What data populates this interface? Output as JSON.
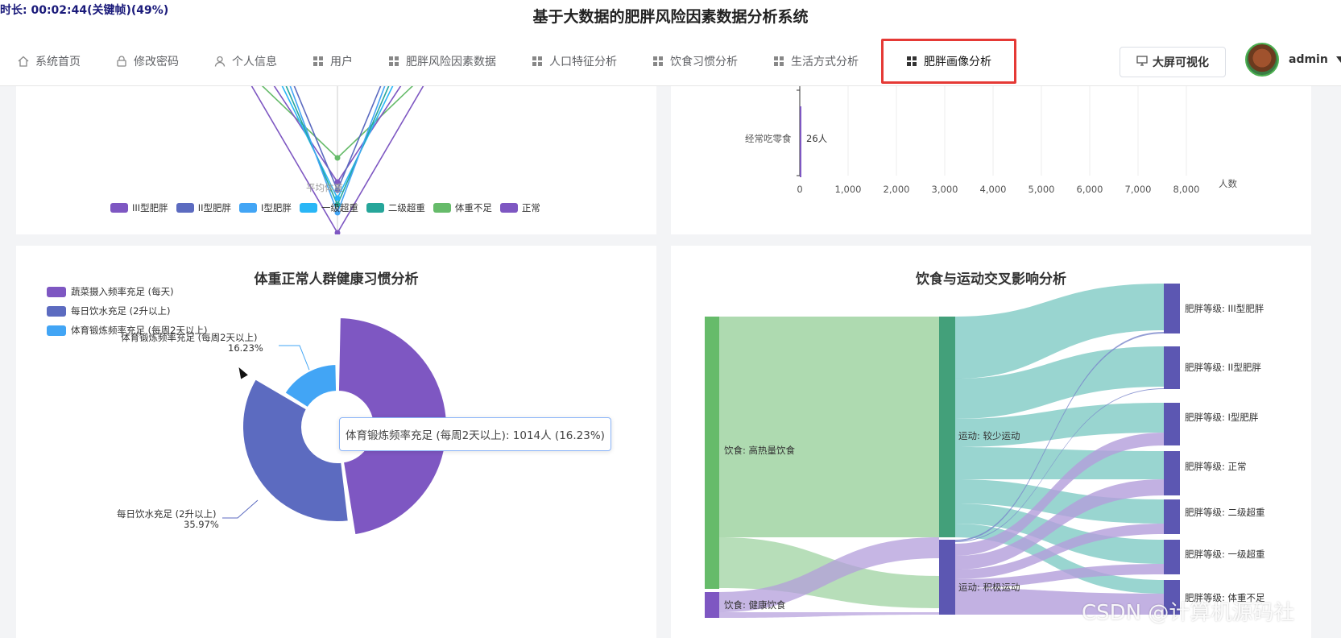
{
  "overlay_timer": "时长: 00:02:44(关键帧)(49%)",
  "header": {
    "title": "基于大数据的肥胖风险因素数据分析系统",
    "nav": [
      {
        "label": "系统首页",
        "icon": "home-icon"
      },
      {
        "label": "修改密码",
        "icon": "lock-icon"
      },
      {
        "label": "个人信息",
        "icon": "user-icon"
      },
      {
        "label": "用户",
        "icon": "grid-icon"
      },
      {
        "label": "肥胖风险因素数据",
        "icon": "grid-icon"
      },
      {
        "label": "人口特征分析",
        "icon": "grid-icon"
      },
      {
        "label": "饮食习惯分析",
        "icon": "grid-icon"
      },
      {
        "label": "生活方式分析",
        "icon": "grid-icon"
      },
      {
        "label": "肥胖画像分析",
        "icon": "grid-icon",
        "active": true
      }
    ],
    "screen_button": "大屏可视化",
    "username": "admin"
  },
  "top_left_chart": {
    "axis_label": "平均体重",
    "legend": [
      {
        "name": "III型肥胖",
        "color": "#7e57c2"
      },
      {
        "name": "II型肥胖",
        "color": "#5c6bc0"
      },
      {
        "name": "I型肥胖",
        "color": "#42a5f5"
      },
      {
        "name": "一级超重",
        "color": "#29b6f6"
      },
      {
        "name": "二级超重",
        "color": "#26a69a"
      },
      {
        "name": "体重不足",
        "color": "#66bb6a"
      },
      {
        "name": "正常",
        "color": "#7e57c2"
      }
    ]
  },
  "top_right_chart": {
    "category": "经常吃零食",
    "bar_label": "26人",
    "axis_name": "人数",
    "ticks": [
      "0",
      "1,000",
      "2,000",
      "3,000",
      "4,000",
      "5,000",
      "6,000",
      "7,000",
      "8,000"
    ]
  },
  "donut": {
    "title": "体重正常人群健康习惯分析",
    "legend": [
      {
        "name": "蔬菜摄入频率充足 (每天)",
        "color": "#7e57c2"
      },
      {
        "name": "每日饮水充足 (2升以上)",
        "color": "#5c6bc0"
      },
      {
        "name": "体育锻炼频率充足 (每周2天以上)",
        "color": "#42a5f5"
      }
    ],
    "label_exercise_name": "体育锻炼频率充足 (每周2天以上)",
    "label_exercise_pct": "16.23%",
    "label_water_name": "每日饮水充足 (2升以上)",
    "label_water_pct": "35.97%",
    "tooltip": "体育锻炼频率充足 (每周2天以上): 1014人 (16.23%)"
  },
  "sankey": {
    "title": "饮食与运动交叉影响分析",
    "nodes_left": [
      "饮食: 高热量饮食",
      "饮食: 健康饮食"
    ],
    "nodes_mid": [
      "运动: 较少运动",
      "运动: 积极运动"
    ],
    "nodes_right": [
      "肥胖等级: III型肥胖",
      "肥胖等级: II型肥胖",
      "肥胖等级: I型肥胖",
      "肥胖等级: 正常",
      "肥胖等级: 二级超重",
      "肥胖等级: 一级超重",
      "肥胖等级: 体重不足"
    ]
  },
  "watermark": "CSDN @计算机源码社",
  "chart_data": [
    {
      "type": "line",
      "xlabel": "平均体重",
      "series": [
        {
          "name": "III型肥胖"
        },
        {
          "name": "II型肥胖"
        },
        {
          "name": "I型肥胖"
        },
        {
          "name": "一级超重"
        },
        {
          "name": "二级超重"
        },
        {
          "name": "体重不足"
        },
        {
          "name": "正常"
        }
      ],
      "legend": "bottom"
    },
    {
      "type": "bar",
      "orientation": "horizontal",
      "categories": [
        "经常吃零食"
      ],
      "values": [
        26
      ],
      "xlabel": "人数",
      "xlim": [
        0,
        8000
      ],
      "ticks": [
        0,
        1000,
        2000,
        3000,
        4000,
        5000,
        6000,
        7000,
        8000
      ]
    },
    {
      "type": "pie",
      "title": "体重正常人群健康习惯分析",
      "slices": [
        {
          "name": "蔬菜摄入频率充足 (每天)",
          "percent": 47.8
        },
        {
          "name": "每日饮水充足 (2升以上)",
          "percent": 35.97
        },
        {
          "name": "体育锻炼频率充足 (每周2天以上)",
          "percent": 16.23,
          "value": 1014
        }
      ],
      "legend": "top-left"
    },
    {
      "type": "sankey",
      "title": "饮食与运动交叉影响分析"
    }
  ]
}
